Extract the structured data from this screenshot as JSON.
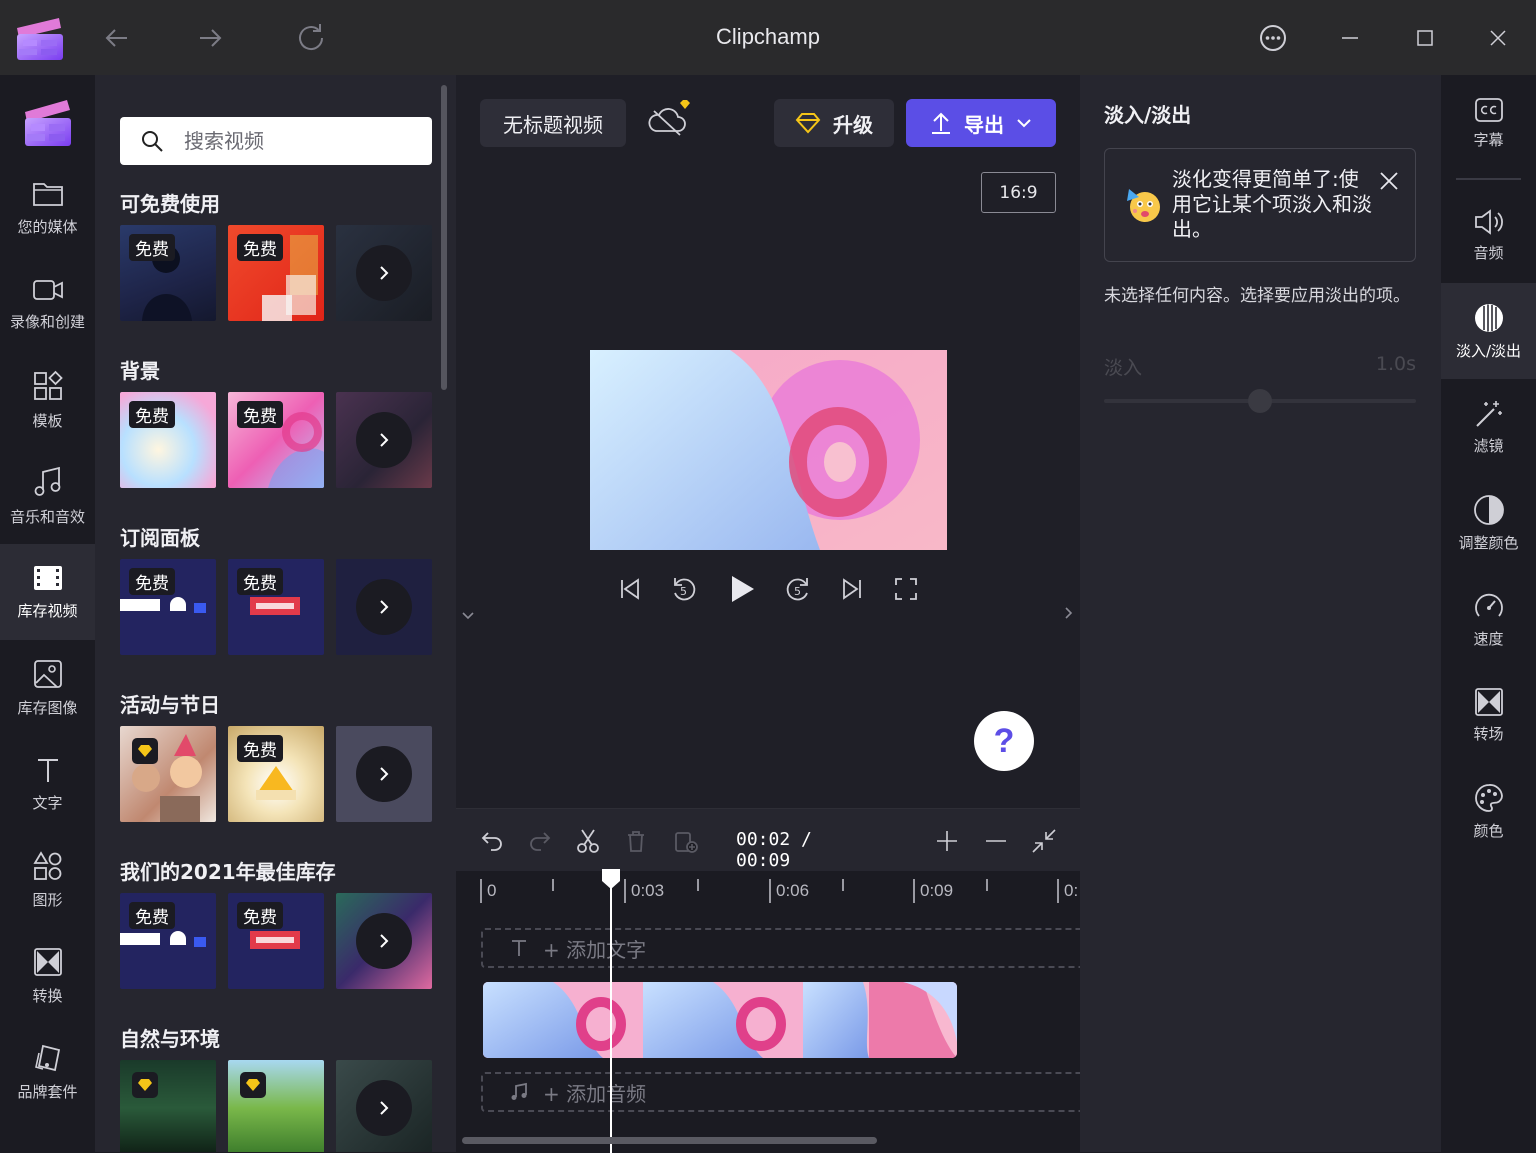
{
  "window": {
    "title": "Clipchamp"
  },
  "left_nav": {
    "items": [
      {
        "label": "您的媒体",
        "icon": "folder-icon"
      },
      {
        "label": "录像和创建",
        "icon": "video-camera-icon"
      },
      {
        "label": "模板",
        "icon": "templates-icon"
      },
      {
        "label": "音乐和音效",
        "icon": "music-note-icon"
      },
      {
        "label": "库存视频",
        "icon": "film-icon",
        "active": true
      },
      {
        "label": "库存图像",
        "icon": "image-icon"
      },
      {
        "label": "文字",
        "icon": "text-icon"
      },
      {
        "label": "图形",
        "icon": "shapes-icon"
      },
      {
        "label": "转换",
        "icon": "transition-icon"
      },
      {
        "label": "品牌套件",
        "icon": "brand-kit-icon"
      }
    ]
  },
  "library": {
    "search_placeholder": "搜索视频",
    "free_badge": "免费",
    "sections": [
      {
        "title": "可免费使用"
      },
      {
        "title": "背景"
      },
      {
        "title": "订阅面板"
      },
      {
        "title": "活动与节日"
      },
      {
        "title": "我们的2021年最佳库存"
      },
      {
        "title": "自然与环境"
      }
    ]
  },
  "preview": {
    "project_title": "无标题视频",
    "upgrade_label": "升级",
    "export_label": "导出",
    "aspect_ratio": "16:9",
    "help_label": "?"
  },
  "timeline": {
    "current_time": "00:02",
    "separator": " / ",
    "total_time": "00:09",
    "ticks": [
      "0",
      "0:03",
      "0:06",
      "0:09",
      "0:"
    ],
    "add_text_label": "+ 添加文字",
    "add_audio_label": "+ 添加音频"
  },
  "properties": {
    "title": "淡入/淡出",
    "tip_text": "淡化变得更简单了:使用它让某个项淡入和淡出。",
    "empty_message": "未选择任何内容。选择要应用淡出的项。",
    "fade_in_label": "淡入",
    "fade_in_value": "1.0s",
    "fade_in_level": 0.5
  },
  "right_rail": {
    "items": [
      {
        "label": "字幕",
        "icon": "captions-icon"
      },
      {
        "label": "音频",
        "icon": "speaker-icon"
      },
      {
        "label": "淡入/淡出",
        "icon": "fade-icon",
        "active": true
      },
      {
        "label": "滤镜",
        "icon": "magic-wand-icon"
      },
      {
        "label": "调整颜色",
        "icon": "contrast-icon"
      },
      {
        "label": "速度",
        "icon": "speedometer-icon"
      },
      {
        "label": "转场",
        "icon": "transition-icon"
      },
      {
        "label": "颜色",
        "icon": "palette-icon"
      }
    ]
  },
  "colors": {
    "accent": "#5b4ee6",
    "panel": "#26262f",
    "background": "#1b1b22",
    "titlebar": "#2a2a2c"
  }
}
